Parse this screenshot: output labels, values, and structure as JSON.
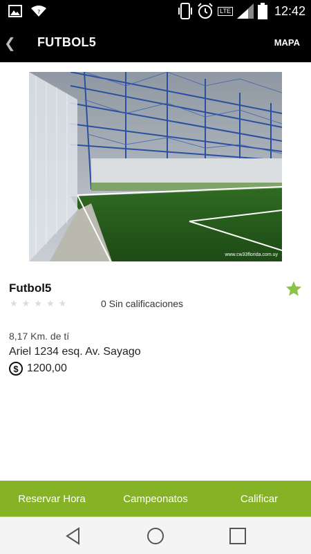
{
  "status_bar": {
    "time": "12:42",
    "network": "LTE",
    "icons": [
      "image-icon",
      "wifi-icon",
      "phone-vibrate-icon",
      "alarm-icon",
      "lte-icon",
      "signal-icon",
      "battery-icon"
    ]
  },
  "appbar": {
    "title": "FUTBOL5",
    "map_label": "MAPA"
  },
  "photo": {
    "watermark": "www.cw33florida.com.uy"
  },
  "venue": {
    "name": "Futbol5",
    "rating_stars": 0,
    "rating_max": 5,
    "rating_text": "0 Sin calificaciones",
    "distance": "8,17 Km. de tí",
    "address": "Ariel 1234 esq. Av. Sayago",
    "price": "1200,00",
    "favorite": true
  },
  "actions": {
    "reserve": "Reservar Hora",
    "championships": "Campeonatos",
    "rate": "Calificar"
  },
  "colors": {
    "accent_green": "#86b325",
    "star_green": "#8bc34a",
    "bar_black": "#000000"
  }
}
